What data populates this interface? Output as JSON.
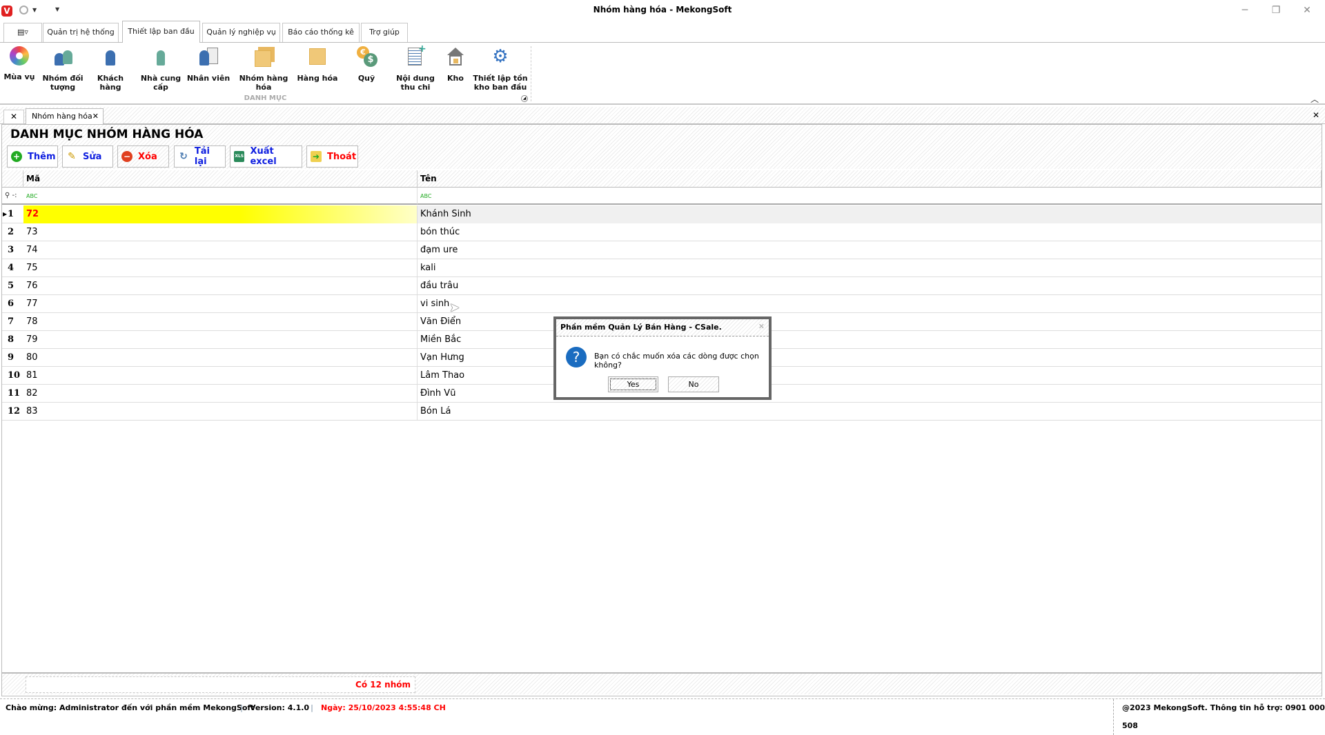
{
  "window": {
    "title": "Nhóm hàng hóa - MekongSoft",
    "logo": "V"
  },
  "ribbon_tabs": [
    {
      "label": "Quản trị hệ thống"
    },
    {
      "label": "Thiết lập ban đầu"
    },
    {
      "label": "Quản lý nghiệp vụ"
    },
    {
      "label": "Báo cáo thống kê"
    },
    {
      "label": "Trợ giúp"
    }
  ],
  "ribbon": {
    "group_label": "DANH MỤC",
    "items": [
      {
        "l1": "Mùa vụ",
        "l2": "",
        "icon": "season-icon"
      },
      {
        "l1": "Nhóm đối",
        "l2": "tượng",
        "icon": "group-users-icon"
      },
      {
        "l1": "Khách",
        "l2": "hàng",
        "icon": "customer-icon"
      },
      {
        "l1": "Nhà cung",
        "l2": "cấp",
        "icon": "supplier-icon"
      },
      {
        "l1": "Nhân viên",
        "l2": "",
        "icon": "employee-icon"
      },
      {
        "l1": "Nhóm hàng",
        "l2": "hóa",
        "icon": "product-group-icon"
      },
      {
        "l1": "Hàng hóa",
        "l2": "",
        "icon": "product-icon"
      },
      {
        "l1": "Quỹ",
        "l2": "",
        "icon": "fund-icon"
      },
      {
        "l1": "Nội dung",
        "l2": "thu chi",
        "icon": "income-expense-icon"
      },
      {
        "l1": "Kho",
        "l2": "",
        "icon": "warehouse-icon"
      },
      {
        "l1": "Thiết lập tồn",
        "l2": "kho ban đầu",
        "icon": "gear-icon"
      }
    ]
  },
  "doc_tab": {
    "label": "Nhóm hàng hóa"
  },
  "page": {
    "heading": "DANH MỤC NHÓM HÀNG HÓA"
  },
  "toolbar": {
    "add": "Thêm",
    "edit": "Sửa",
    "delete": "Xóa",
    "reload": "Tải lại",
    "export": "Xuất excel",
    "exit": "Thoát"
  },
  "grid": {
    "columns": [
      "Mã",
      "Tên"
    ],
    "filter_icon_text": "ABC",
    "rows": [
      {
        "n": "1",
        "ma": "72",
        "ten": "Khánh Sinh"
      },
      {
        "n": "2",
        "ma": "73",
        "ten": "bón thúc"
      },
      {
        "n": "3",
        "ma": "74",
        "ten": "đạm ure"
      },
      {
        "n": "4",
        "ma": "75",
        "ten": "kali"
      },
      {
        "n": "5",
        "ma": "76",
        "ten": "đầu trâu"
      },
      {
        "n": "6",
        "ma": "77",
        "ten": "vi sinh"
      },
      {
        "n": "7",
        "ma": "78",
        "ten": "Văn Điển"
      },
      {
        "n": "8",
        "ma": "79",
        "ten": "Miền Bắc"
      },
      {
        "n": "9",
        "ma": "80",
        "ten": "Vạn Hưng"
      },
      {
        "n": "10",
        "ma": "81",
        "ten": "Lâm Thao"
      },
      {
        "n": "11",
        "ma": "82",
        "ten": "Đình Vũ"
      },
      {
        "n": "12",
        "ma": "83",
        "ten": "Bón Lá"
      }
    ]
  },
  "summary": {
    "count": "Có 12 nhóm"
  },
  "status": {
    "welcome": "Chào mừng: Administrator đến với phần mềm MekongSoft",
    "version": "Version: 4.1.0",
    "date": "Ngày: 25/10/2023 4:55:48 CH",
    "copyright": "@2023 MekongSoft. Thông tin hỗ trợ: 0901 000 508"
  },
  "dialog": {
    "title": "Phần mềm Quản Lý Bán Hàng - CSale.",
    "message": "Bạn có chắc muốn xóa các dòng được chọn không?",
    "yes": "Yes",
    "no": "No"
  },
  "colors": {
    "accent_blue": "#1020e0",
    "red": "#ff0000",
    "selected_row": "#ffff00"
  }
}
